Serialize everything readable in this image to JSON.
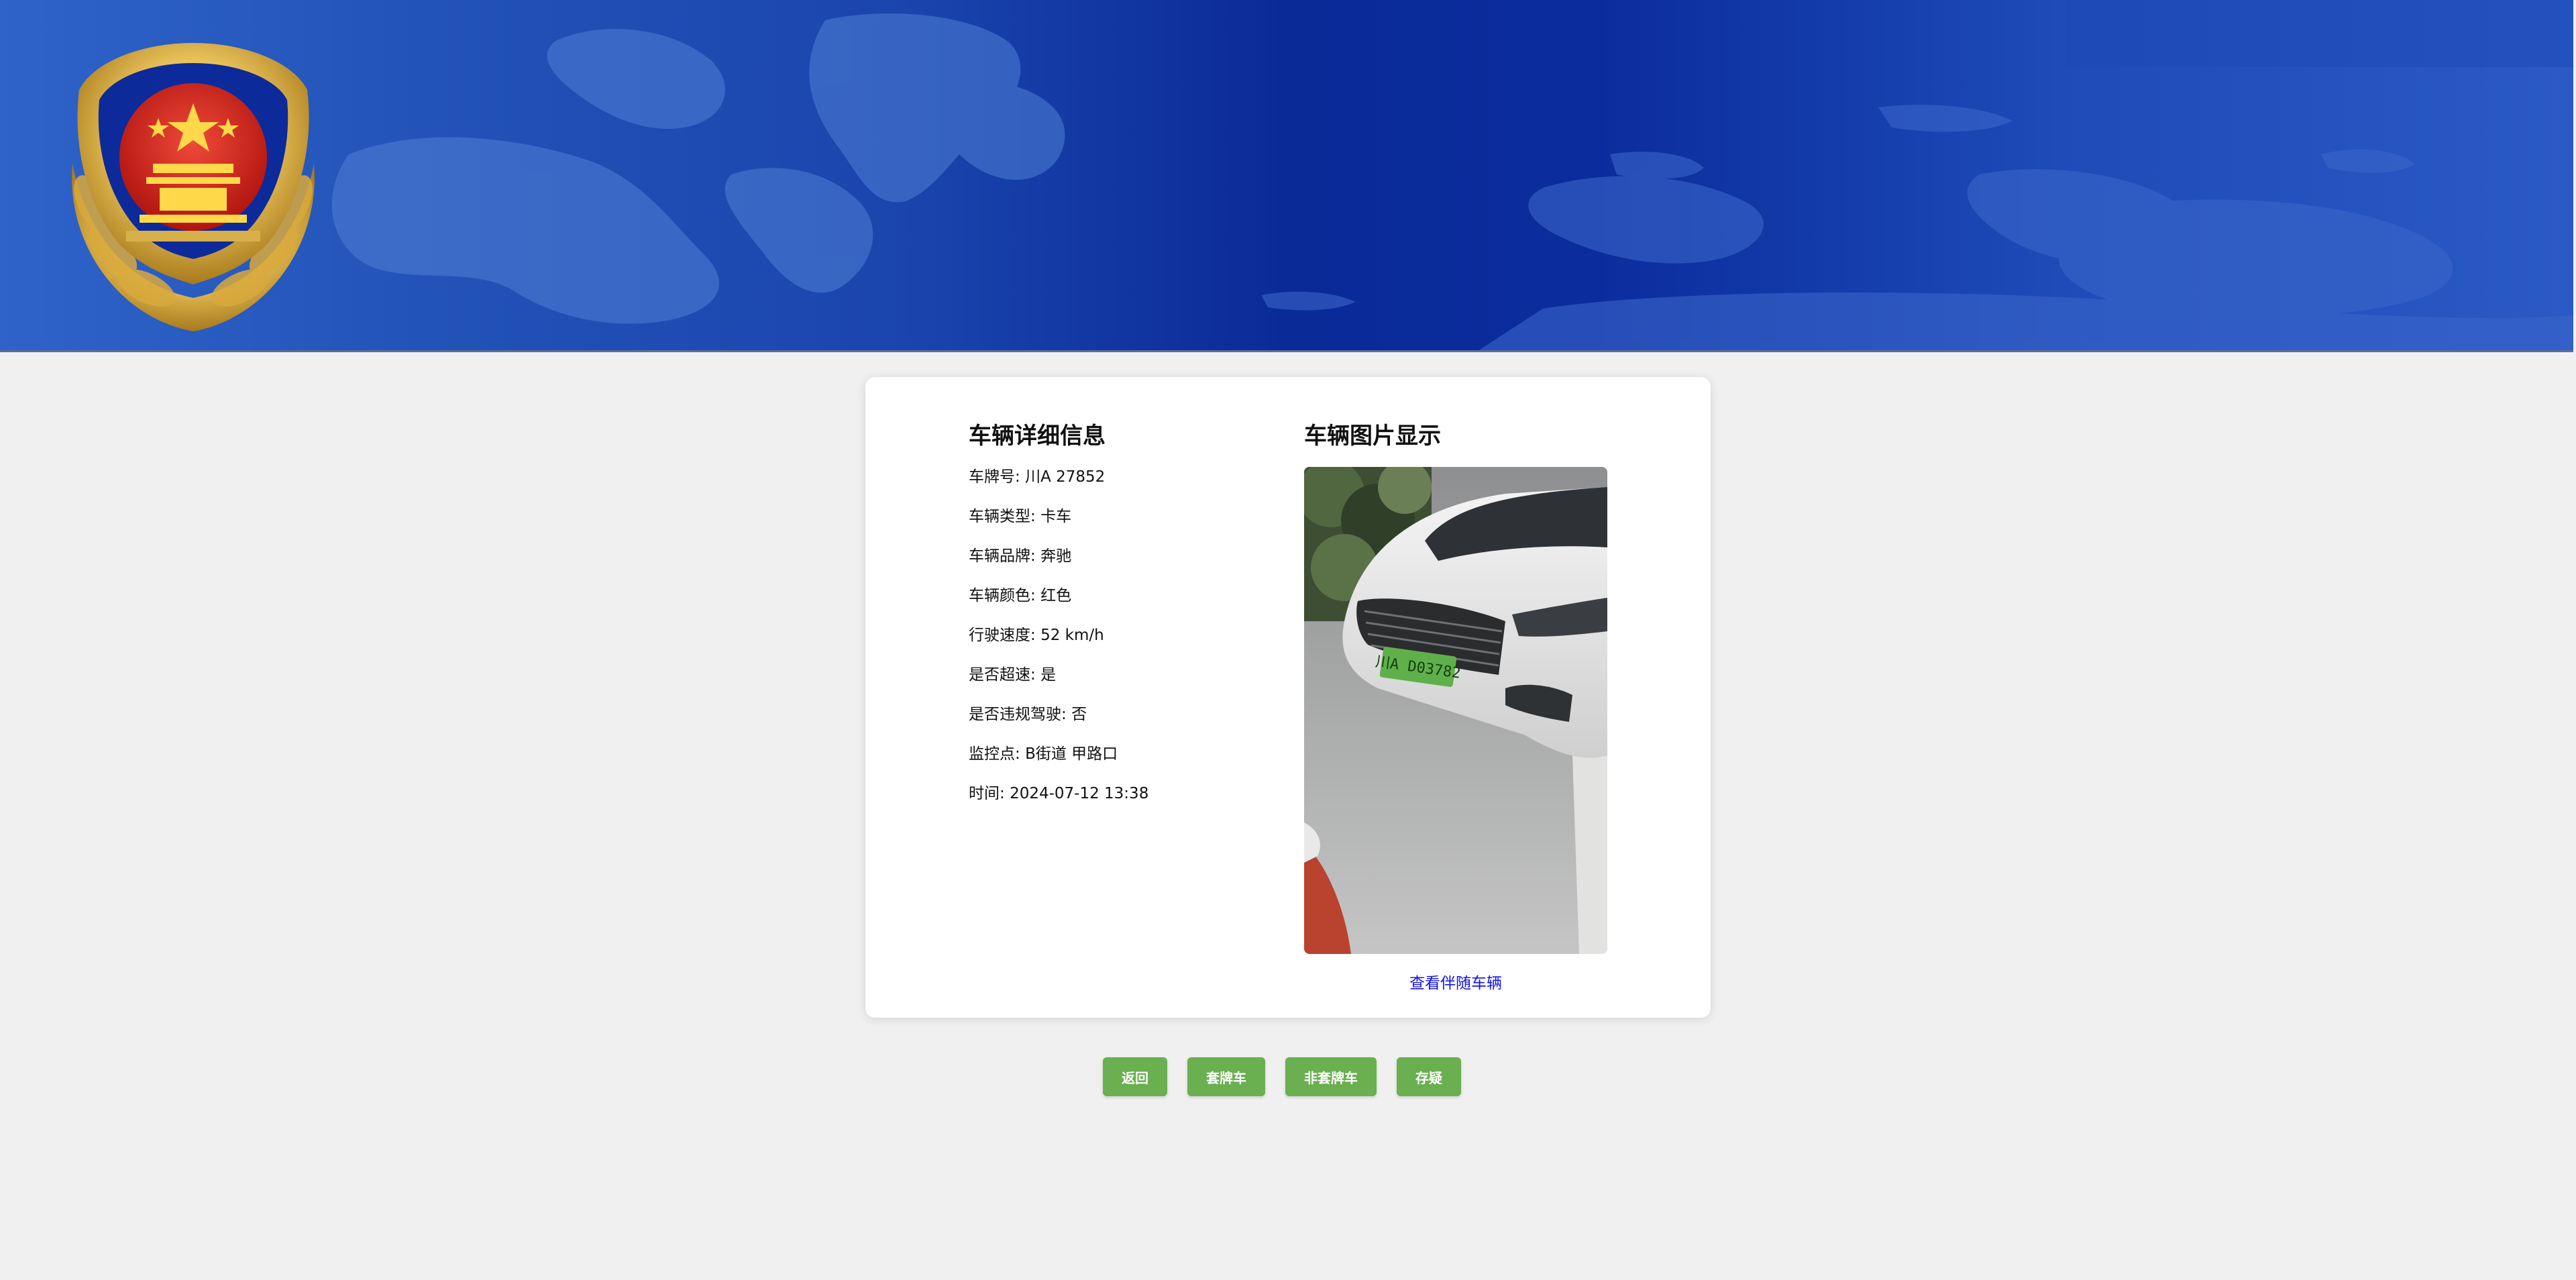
{
  "header": {
    "emblem_icon": "police-emblem-icon"
  },
  "vehicle_details": {
    "title": "车辆详细信息",
    "fields": [
      {
        "label": "车牌号",
        "value": "川A 27852"
      },
      {
        "label": "车辆类型",
        "value": "卡车"
      },
      {
        "label": "车辆品牌",
        "value": "奔驰"
      },
      {
        "label": "车辆颜色",
        "value": "红色"
      },
      {
        "label": "行驶速度",
        "value": "52 km/h"
      },
      {
        "label": "是否超速",
        "value": "是"
      },
      {
        "label": "是否违规驾驶",
        "value": "否"
      },
      {
        "label": "监控点",
        "value": "B街道 甲路口"
      },
      {
        "label": "时间",
        "value": "2024-07-12 13:38"
      }
    ]
  },
  "vehicle_image": {
    "title": "车辆图片显示",
    "plate_text": "川A D03782",
    "companion_link": "查看伴随车辆"
  },
  "actions": {
    "back": "返回",
    "cloned_plate": "套牌车",
    "not_cloned_plate": "非套牌车",
    "suspicious": "存疑"
  },
  "colors": {
    "button": "#6aaf50",
    "link": "#1212ee",
    "banner": "#0a2a98"
  }
}
